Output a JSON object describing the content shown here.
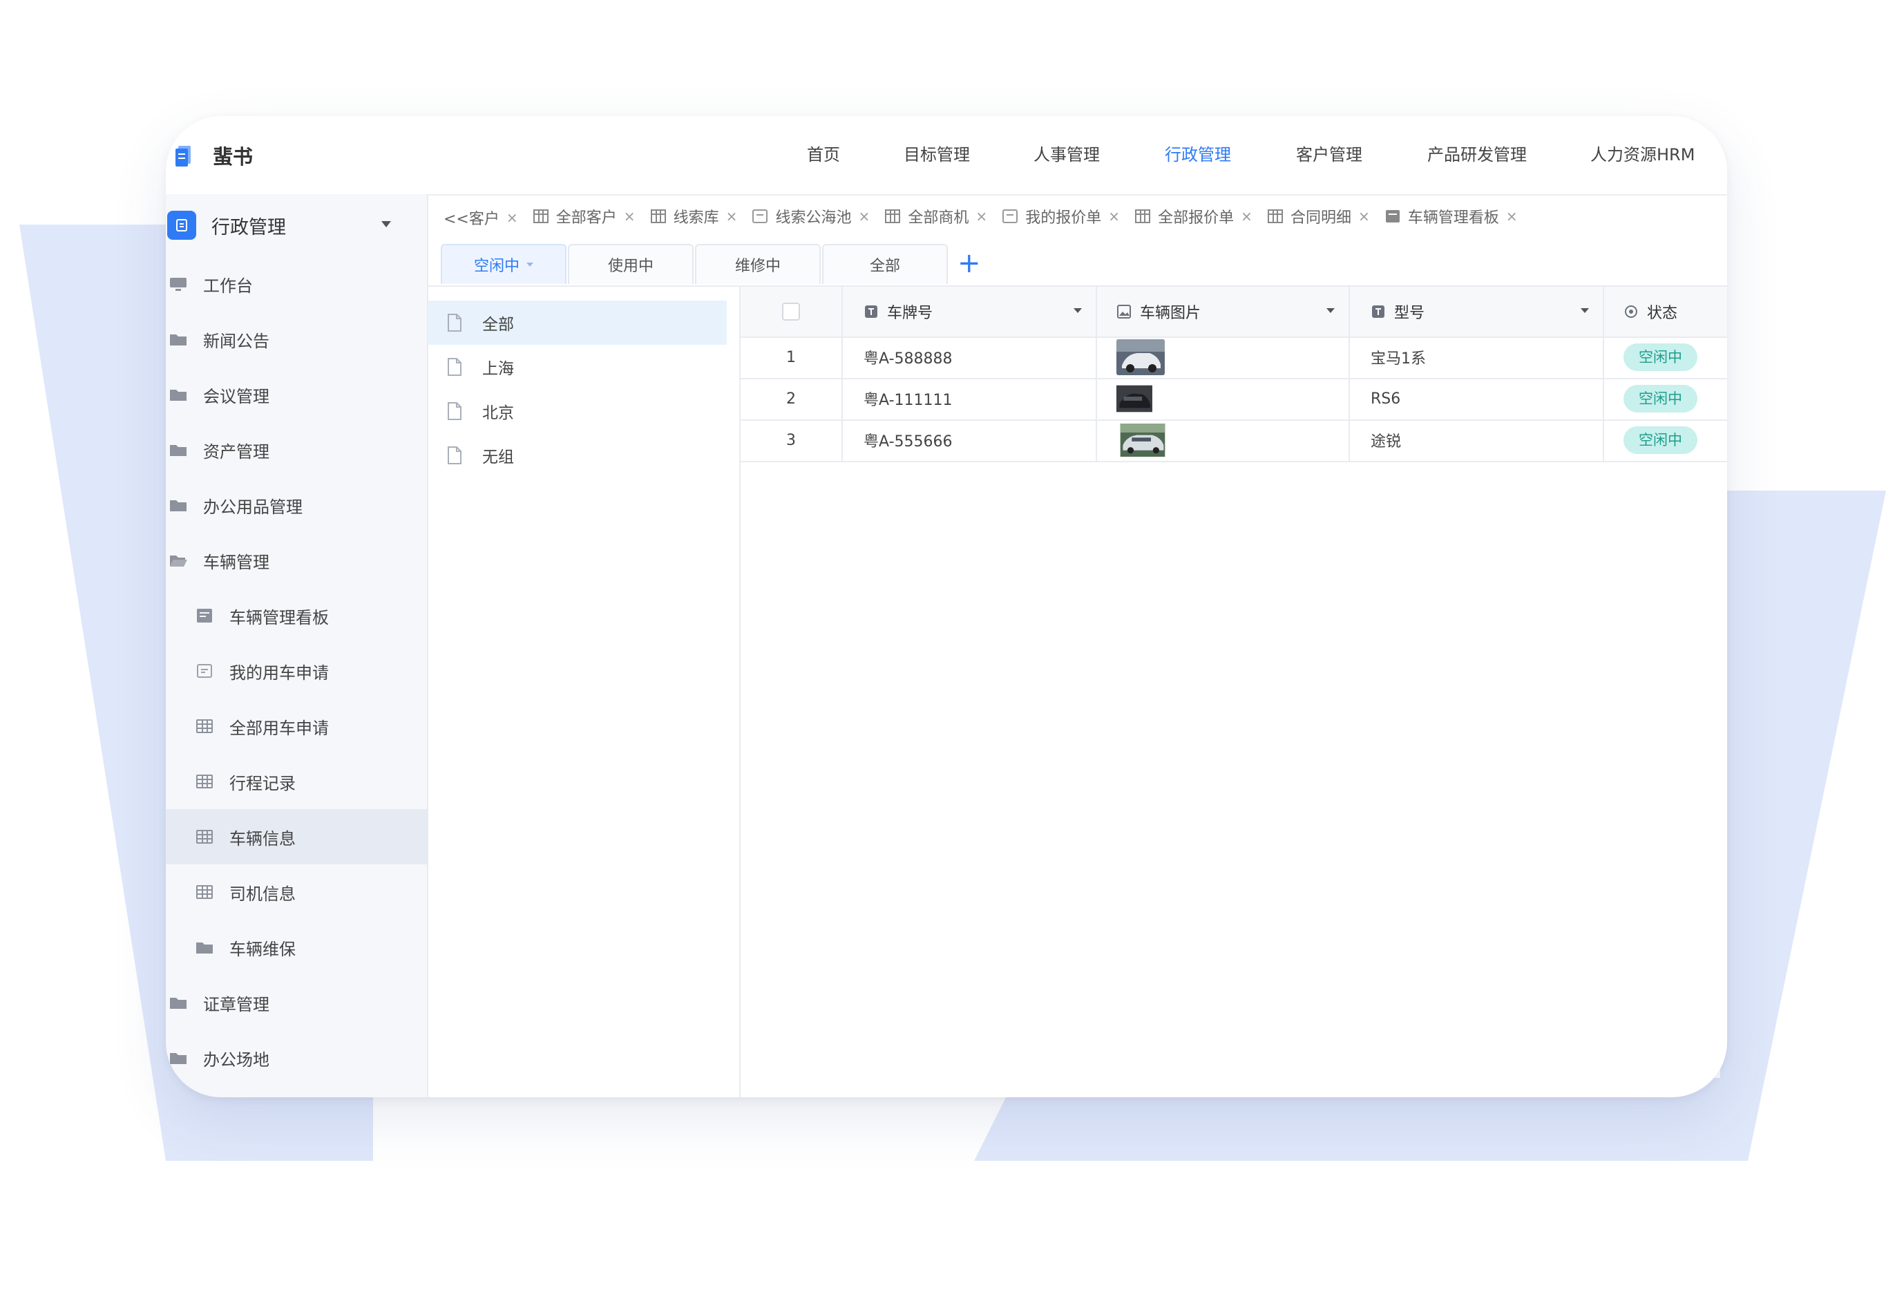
{
  "app": {
    "name": "蜚书"
  },
  "top_menu": [
    {
      "label": "首页",
      "active": false
    },
    {
      "label": "目标管理",
      "active": false
    },
    {
      "label": "人事管理",
      "active": false
    },
    {
      "label": "行政管理",
      "active": true
    },
    {
      "label": "客户管理",
      "active": false
    },
    {
      "label": "产品研发管理",
      "active": false
    },
    {
      "label": "人力资源HRM",
      "active": false
    }
  ],
  "sidebar": {
    "title": "行政管理",
    "items": [
      {
        "label": "工作台",
        "icon": "monitor-icon",
        "level": 0
      },
      {
        "label": "新闻公告",
        "icon": "folder-icon",
        "level": 0
      },
      {
        "label": "会议管理",
        "icon": "folder-icon",
        "level": 0
      },
      {
        "label": "资产管理",
        "icon": "folder-icon",
        "level": 0
      },
      {
        "label": "办公用品管理",
        "icon": "folder-icon",
        "level": 0
      },
      {
        "label": "车辆管理",
        "icon": "folder-open-icon",
        "level": 0
      },
      {
        "label": "车辆管理看板",
        "icon": "dashboard-icon",
        "level": 1
      },
      {
        "label": "我的用车申请",
        "icon": "form-icon",
        "level": 1
      },
      {
        "label": "全部用车申请",
        "icon": "table-icon",
        "level": 1
      },
      {
        "label": "行程记录",
        "icon": "table-icon",
        "level": 1
      },
      {
        "label": "车辆信息",
        "icon": "table-icon",
        "level": 1,
        "active": true
      },
      {
        "label": "司机信息",
        "icon": "table-icon",
        "level": 1
      },
      {
        "label": "车辆维保",
        "icon": "folder-icon",
        "level": 1
      },
      {
        "label": "证章管理",
        "icon": "folder-icon",
        "level": 0
      },
      {
        "label": "办公场地",
        "icon": "folder-icon",
        "level": 0
      }
    ]
  },
  "view_tabs": [
    {
      "label": "<<客户",
      "icon": ""
    },
    {
      "label": "全部客户",
      "icon": "table-icon"
    },
    {
      "label": "线索库",
      "icon": "table-icon"
    },
    {
      "label": "线索公海池",
      "icon": "form-icon"
    },
    {
      "label": "全部商机",
      "icon": "table-icon"
    },
    {
      "label": "我的报价单",
      "icon": "form-icon"
    },
    {
      "label": "全部报价单",
      "icon": "table-icon"
    },
    {
      "label": "合同明细",
      "icon": "table-icon"
    },
    {
      "label": "车辆管理看板",
      "icon": "dashboard-icon"
    }
  ],
  "filter_tabs": [
    {
      "label": "空闲中",
      "active": true
    },
    {
      "label": "使用中",
      "active": false
    },
    {
      "label": "维修中",
      "active": false
    },
    {
      "label": "全部",
      "active": false
    }
  ],
  "groups": [
    {
      "label": "全部",
      "active": true
    },
    {
      "label": "上海",
      "active": false
    },
    {
      "label": "北京",
      "active": false
    },
    {
      "label": "无组",
      "active": false
    }
  ],
  "table": {
    "columns": [
      {
        "label": "车牌号",
        "icon": "text-field-icon"
      },
      {
        "label": "车辆图片",
        "icon": "image-field-icon"
      },
      {
        "label": "型号",
        "icon": "text-field-icon"
      },
      {
        "label": "状态",
        "icon": "status-field-icon"
      }
    ],
    "rows": [
      {
        "index": "1",
        "plate": "粤A-588888",
        "model": "宝马1系",
        "status": "空闲中"
      },
      {
        "index": "2",
        "plate": "粤A-111111",
        "model": "RS6",
        "status": "空闲中"
      },
      {
        "index": "3",
        "plate": "粤A-555666",
        "model": "途锐",
        "status": "空闲中"
      }
    ]
  },
  "colors": {
    "accent": "#2f7bf5",
    "status_bg": "#c8f0ec",
    "status_text": "#1d9e8e",
    "backdrop": "#dfe7fa"
  }
}
